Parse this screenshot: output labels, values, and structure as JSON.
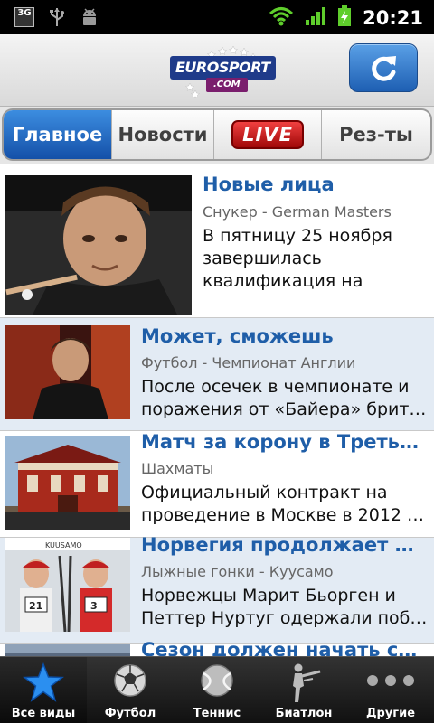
{
  "status_bar": {
    "network": "3G",
    "time": "20:21"
  },
  "header": {
    "logo_top": "EUROSPORT",
    "logo_bottom": ".COM"
  },
  "tabs": [
    {
      "label": "Главное",
      "active": true
    },
    {
      "label": "Новости",
      "active": false
    },
    {
      "label": "LIVE",
      "active": false
    },
    {
      "label": "Рез-ты",
      "active": false
    }
  ],
  "articles": [
    {
      "title": "Новые лица",
      "category": "Снукер - German Masters",
      "desc_line1": "В пятницу 25 ноября",
      "desc_line2": "завершилась",
      "desc_line3": "квалификация на"
    },
    {
      "title": "Может, сможешь",
      "category": "Футбол - Чемпионат Англии",
      "desc_line1": "После осечек в чемпионате и",
      "desc_line2": "поражения от «Байера» брит…"
    },
    {
      "title": "Матч за корону в Треть…",
      "category": "Шахматы",
      "desc_line1": "Официальный контракт на",
      "desc_line2": "проведение в Москве в 2012 …"
    },
    {
      "title": "Норвегия продолжает …",
      "category": "Лыжные гонки - Куусамо",
      "desc_line1": "Норвежцы Марит Бьорген и",
      "desc_line2": "Петтер Нуртуг одержали побе…",
      "photo_sign": "KUUSAMO"
    },
    {
      "title": "Сезон должен начать с…"
    }
  ],
  "bottom_nav": [
    {
      "label": "Все виды",
      "icon": "star-icon",
      "active": true
    },
    {
      "label": "Футбол",
      "icon": "soccer-ball-icon",
      "active": false
    },
    {
      "label": "Теннис",
      "icon": "tennis-ball-icon",
      "active": false
    },
    {
      "label": "Биатлон",
      "icon": "biathlon-icon",
      "active": false
    },
    {
      "label": "Другие",
      "icon": "more-dots-icon",
      "active": false
    }
  ],
  "colors": {
    "accent_blue": "#1f5ea8",
    "tab_active": "#1e5fb3",
    "live_red": "#d01818",
    "row_alt": "#e3ebf4"
  }
}
